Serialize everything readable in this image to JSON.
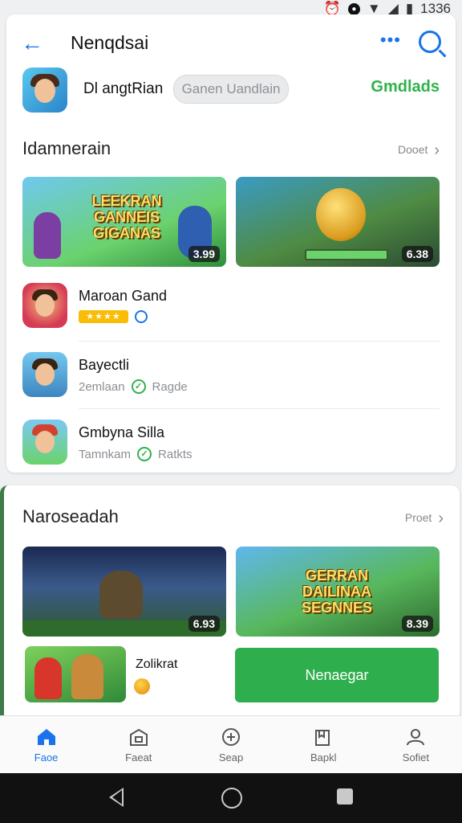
{
  "status_bar": {
    "time": "1336"
  },
  "header": {
    "title": "Nenqdsai"
  },
  "developer": {
    "name": "Dl angtRian",
    "pill_label": "Ganen Uandlain",
    "follow_label": "Gmdlads"
  },
  "section1": {
    "title": "Idamnerain",
    "more_label": "Dooet",
    "banners": [
      {
        "text": "LEEKRAN GANNEIS GIGANAS",
        "price": "3.99"
      },
      {
        "price": "6.38"
      }
    ],
    "apps": [
      {
        "name": "Maroan Gand",
        "rating_label": "★★★★"
      },
      {
        "name": "Bayectli",
        "sub1": "2emlaan",
        "sub2": "Ragde"
      },
      {
        "name": "Gmbyna Silla",
        "sub1": "Tamnkam",
        "sub2": "Ratkts"
      }
    ]
  },
  "section2": {
    "title": "Naroseadah",
    "more_label": "Proet",
    "banners": [
      {
        "price": "6.93"
      },
      {
        "text": "GERRAN DAILINAA SEGNNES",
        "price": "8.39"
      }
    ],
    "promo": {
      "name": "Zolikrat",
      "button_label": "Nenaegar"
    }
  },
  "bottom_nav": [
    {
      "label": "Faoe",
      "icon": "home-icon",
      "active": true
    },
    {
      "label": "Faeat",
      "icon": "store-icon",
      "active": false
    },
    {
      "label": "Seap",
      "icon": "gamepad-icon",
      "active": false
    },
    {
      "label": "Bapkl",
      "icon": "book-icon",
      "active": false
    },
    {
      "label": "Sofiet",
      "icon": "person-icon",
      "active": false
    }
  ],
  "colors": {
    "accent": "#1a73e8",
    "green": "#2fae4e",
    "star": "#fbbc05"
  }
}
